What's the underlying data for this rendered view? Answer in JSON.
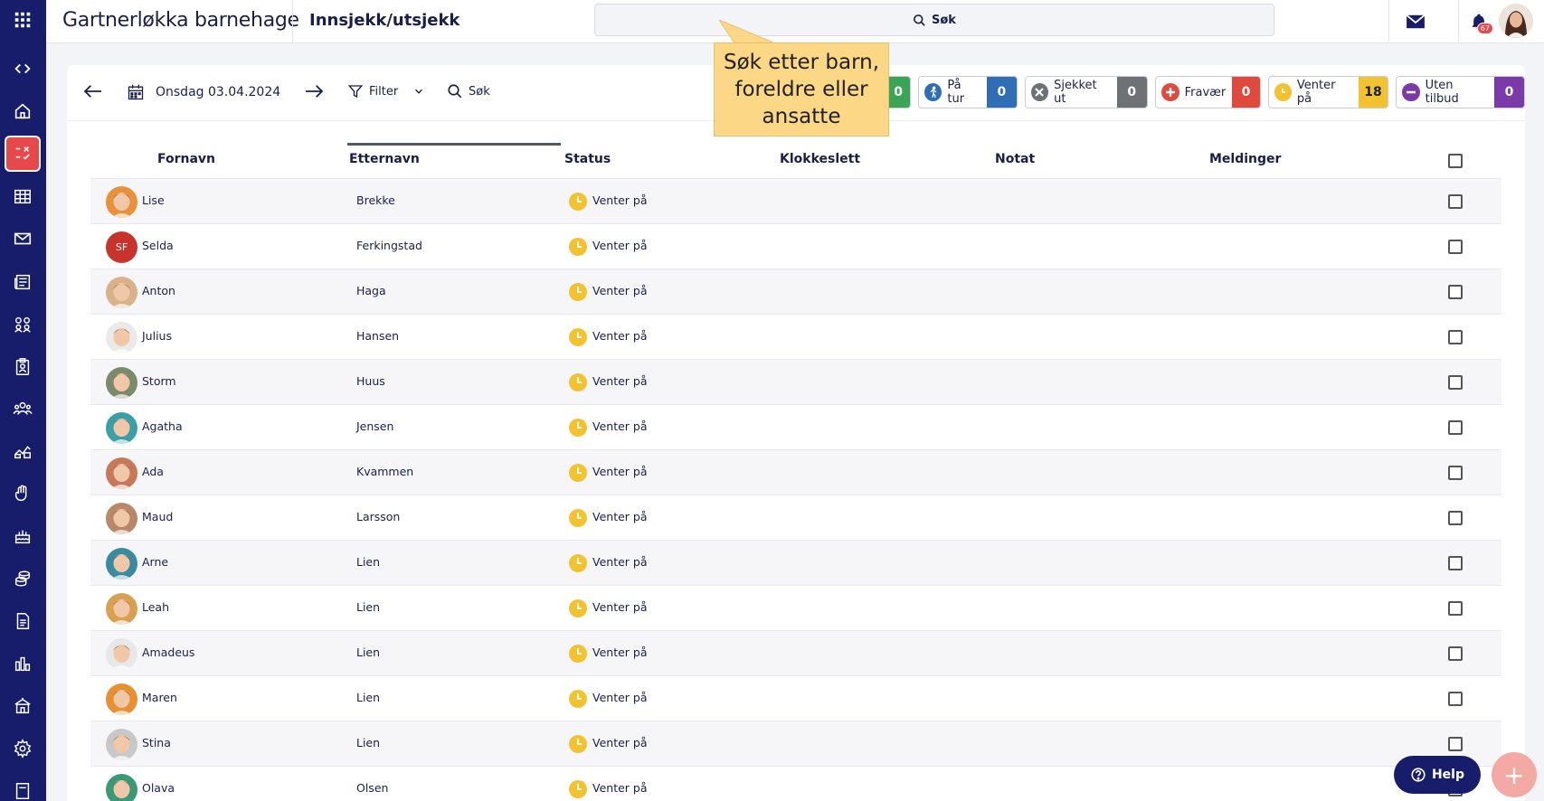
{
  "app": {
    "org_name": "Gartnerløkka barnehage",
    "page_title": "Innsjekk/utsjekk"
  },
  "global_search": {
    "label": "Søk"
  },
  "topbar": {
    "notification_count": "67"
  },
  "toolbar": {
    "date_label": "Onsdag 03.04.2024",
    "filter_label": "Filter",
    "search_label": "Søk"
  },
  "tooltip": {
    "text": "Søk etter barn, foreldre eller ansatte"
  },
  "chips": [
    {
      "label": "",
      "count": "0",
      "color": "#3aa556",
      "icon": "check-in-icon"
    },
    {
      "label": "På tur",
      "count": "0",
      "color": "#2f6db5",
      "icon": "walking-icon"
    },
    {
      "label": "Sjekket ut",
      "count": "0",
      "color": "#6e7275",
      "icon": "x-circle-icon"
    },
    {
      "label": "Fravær",
      "count": "0",
      "color": "#e04a3c",
      "icon": "plus-circle-icon"
    },
    {
      "label": "Venter på",
      "count": "18",
      "color": "#f2c230",
      "icon": "clock-icon"
    },
    {
      "label": "Uten tilbud",
      "count": "0",
      "color": "#7b3aa8",
      "icon": "minus-circle-icon"
    }
  ],
  "table": {
    "columns": [
      "Fornavn",
      "Etternavn",
      "Status",
      "Klokkeslett",
      "Notat",
      "Meldinger"
    ],
    "rows": [
      {
        "first": "Lise",
        "last": "Brekke",
        "status": "Venter på",
        "avatar_color": "#e8903a",
        "initials": ""
      },
      {
        "first": "Selda",
        "last": "Ferkingstad",
        "status": "Venter på",
        "avatar_color": "#c8342c",
        "initials": "SF"
      },
      {
        "first": "Anton",
        "last": "Haga",
        "status": "Venter på",
        "avatar_color": "#d8b28a",
        "initials": ""
      },
      {
        "first": "Julius",
        "last": "Hansen",
        "status": "Venter på",
        "avatar_color": "#eaeaea",
        "initials": ""
      },
      {
        "first": "Storm",
        "last": "Huus",
        "status": "Venter på",
        "avatar_color": "#7a8a6a",
        "initials": ""
      },
      {
        "first": "Agatha",
        "last": "Jensen",
        "status": "Venter på",
        "avatar_color": "#3aa0a8",
        "initials": ""
      },
      {
        "first": "Ada",
        "last": "Kvammen",
        "status": "Venter på",
        "avatar_color": "#c8785a",
        "initials": ""
      },
      {
        "first": "Maud",
        "last": "Larsson",
        "status": "Venter på",
        "avatar_color": "#b88868",
        "initials": ""
      },
      {
        "first": "Arne",
        "last": "Lien",
        "status": "Venter på",
        "avatar_color": "#3a8aa0",
        "initials": ""
      },
      {
        "first": "Leah",
        "last": "Lien",
        "status": "Venter på",
        "avatar_color": "#d8a050",
        "initials": ""
      },
      {
        "first": "Amadeus",
        "last": "Lien",
        "status": "Venter på",
        "avatar_color": "#e8e8e8",
        "initials": ""
      },
      {
        "first": "Maren",
        "last": "Lien",
        "status": "Venter på",
        "avatar_color": "#e89030",
        "initials": ""
      },
      {
        "first": "Stina",
        "last": "Lien",
        "status": "Venter på",
        "avatar_color": "#c8c8c8",
        "initials": ""
      },
      {
        "first": "Olava",
        "last": "Olsen",
        "status": "Venter på",
        "avatar_color": "#3a9a78",
        "initials": ""
      }
    ]
  },
  "help_button": {
    "label": "Help"
  }
}
